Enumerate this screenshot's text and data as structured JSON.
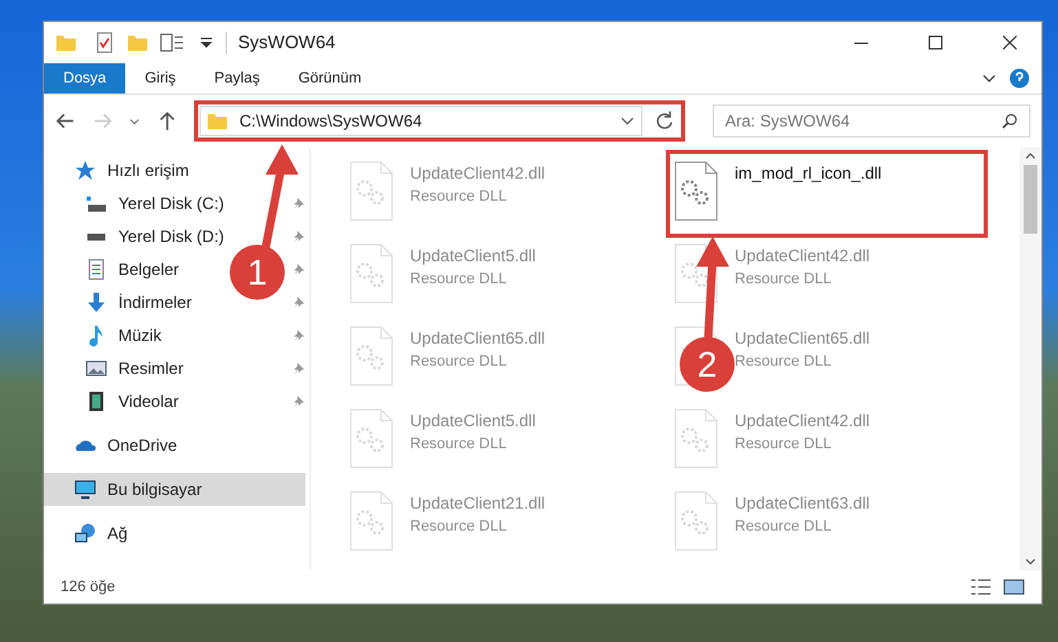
{
  "window": {
    "title": "SysWOW64"
  },
  "ribbon_tabs": [
    {
      "label": "Dosya",
      "selected": true
    },
    {
      "label": "Giriş",
      "selected": false
    },
    {
      "label": "Paylaş",
      "selected": false
    },
    {
      "label": "Görünüm",
      "selected": false
    }
  ],
  "address_bar": {
    "path": "C:\\Windows\\SysWOW64"
  },
  "search": {
    "placeholder": "Ara: SysWOW64"
  },
  "sidebar": {
    "items": [
      {
        "label": "Hızlı erişim",
        "kind": "star",
        "selected": false,
        "children": [
          {
            "label": "Yerel Disk (C:)",
            "kind": "drive-win",
            "pinned": true,
            "selected": false
          },
          {
            "label": "Yerel Disk (D:)",
            "kind": "drive",
            "pinned": true,
            "selected": false
          },
          {
            "label": "Belgeler",
            "kind": "doc",
            "pinned": true,
            "selected": false
          },
          {
            "label": "İndirmeler",
            "kind": "download",
            "pinned": true,
            "selected": false
          },
          {
            "label": "Müzik",
            "kind": "music",
            "pinned": true,
            "selected": false
          },
          {
            "label": "Resimler",
            "kind": "picture",
            "pinned": true,
            "selected": false
          },
          {
            "label": "Videolar",
            "kind": "video",
            "pinned": true,
            "selected": false
          }
        ]
      },
      {
        "label": "OneDrive",
        "kind": "cloud",
        "selected": false
      },
      {
        "label": "Bu bilgisayar",
        "kind": "pc",
        "selected": true
      },
      {
        "label": "Ağ",
        "kind": "network",
        "selected": false
      }
    ]
  },
  "files": [
    [
      {
        "name": "UpdateClient42.dll",
        "type": "Resource DLL",
        "highlighted": false
      },
      {
        "name": "UpdateClient5.dll",
        "type": "Resource DLL",
        "highlighted": false
      },
      {
        "name": "UpdateClient65.dll",
        "type": "Resource DLL",
        "highlighted": false
      },
      {
        "name": "UpdateClient5.dll",
        "type": "Resource DLL",
        "highlighted": false
      },
      {
        "name": "UpdateClient21.dll",
        "type": "Resource DLL",
        "highlighted": false
      }
    ],
    [
      {
        "name": "im_mod_rl_icon_.dll",
        "highlighted": true
      },
      {
        "name": "UpdateClient42.dll",
        "type": "Resource DLL",
        "highlighted": false
      },
      {
        "name": "UpdateClient65.dll",
        "type": "Resource DLL",
        "highlighted": false
      },
      {
        "name": "UpdateClient42.dll",
        "type": "Resource DLL",
        "highlighted": false
      },
      {
        "name": "UpdateClient63.dll",
        "type": "Resource DLL",
        "highlighted": false
      }
    ]
  ],
  "status_bar": {
    "count": "126 öğe"
  },
  "annotations": [
    {
      "number": "1"
    },
    {
      "number": "2"
    }
  ]
}
